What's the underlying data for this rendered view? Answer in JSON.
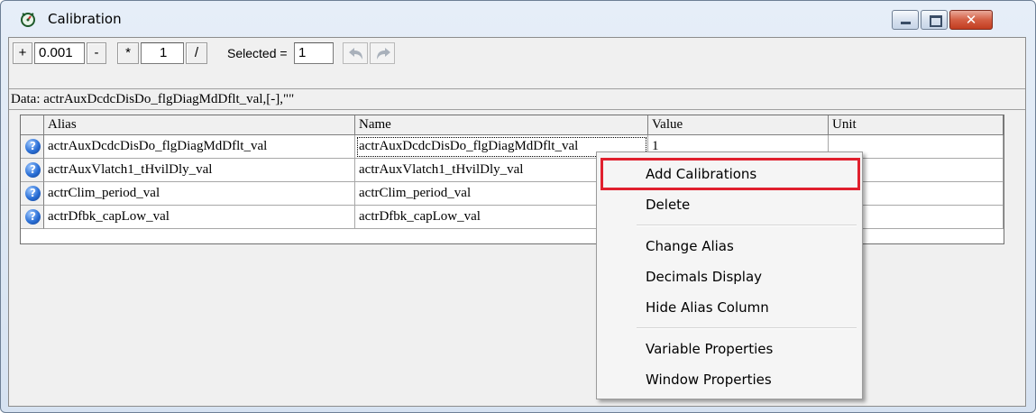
{
  "window": {
    "title": "Calibration",
    "close_glyph": "✕"
  },
  "toolbar": {
    "plus": "+",
    "step_value": "0.001",
    "minus": "-",
    "multiply": "*",
    "factor_value": "1",
    "divide": "/",
    "selected_label": "Selected =",
    "selected_value": "1",
    "undo_icon": "undo-arrow-icon",
    "redo_icon": "redo-arrow-icon"
  },
  "data_line": "Data: actrAuxDcdcDisDo_flgDiagMdDflt_val,[-],\"\"",
  "table": {
    "columns": [
      "Alias",
      "Name",
      "Value",
      "Unit"
    ],
    "rows": [
      {
        "alias": "actrAuxDcdcDisDo_flgDiagMdDflt_val",
        "name": "actrAuxDcdcDisDo_flgDiagMdDflt_val",
        "value": "1",
        "unit": ""
      },
      {
        "alias": "actrAuxVlatch1_tHvilDly_val",
        "name": "actrAuxVlatch1_tHvilDly_val",
        "value": "",
        "unit": ""
      },
      {
        "alias": "actrClim_period_val",
        "name": "actrClim_period_val",
        "value": "",
        "unit": ""
      },
      {
        "alias": "actrDfbk_capLow_val",
        "name": "actrDfbk_capLow_val",
        "value": "",
        "unit": ""
      }
    ],
    "row_icon_glyph": "?"
  },
  "context_menu": {
    "items": [
      "Add Calibrations",
      "Delete",
      "Change Alias",
      "Decimals Display",
      "Hide Alias Column",
      "Variable Properties",
      "Window Properties"
    ],
    "highlighted": "Add Calibrations",
    "highlight_color": "#e0202e"
  }
}
